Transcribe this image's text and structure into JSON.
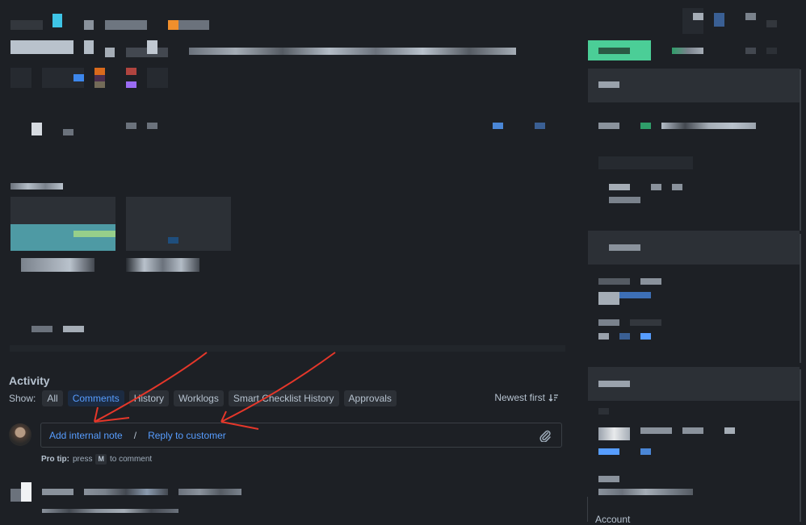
{
  "redacted_note": "Upper page content and sidebar values are pixelated/redacted in the screenshot",
  "activity": {
    "title": "Activity",
    "show_label": "Show:",
    "tabs": [
      {
        "label": "All",
        "active": false
      },
      {
        "label": "Comments",
        "active": true
      },
      {
        "label": "History",
        "active": false
      },
      {
        "label": "Worklogs",
        "active": false
      },
      {
        "label": "Smart Checklist History",
        "active": false
      },
      {
        "label": "Approvals",
        "active": false
      }
    ],
    "sort_label": "Newest first",
    "sort_icon": "sort-descending-icon"
  },
  "composer": {
    "add_internal_note": "Add internal note",
    "separator": "/",
    "reply_to_customer": "Reply to customer",
    "attach_icon": "paperclip-icon",
    "pro_tip_label": "Pro tip:",
    "pro_tip_pre": "press",
    "pro_tip_key": "M",
    "pro_tip_post": "to comment"
  },
  "sidebar": {
    "account_label": "Account"
  },
  "colors": {
    "background": "#1d2025",
    "link": "#579dff",
    "active_tab_bg": "#1c2b41",
    "primary_button": "#4bce97",
    "annotation": "#e5372a"
  }
}
